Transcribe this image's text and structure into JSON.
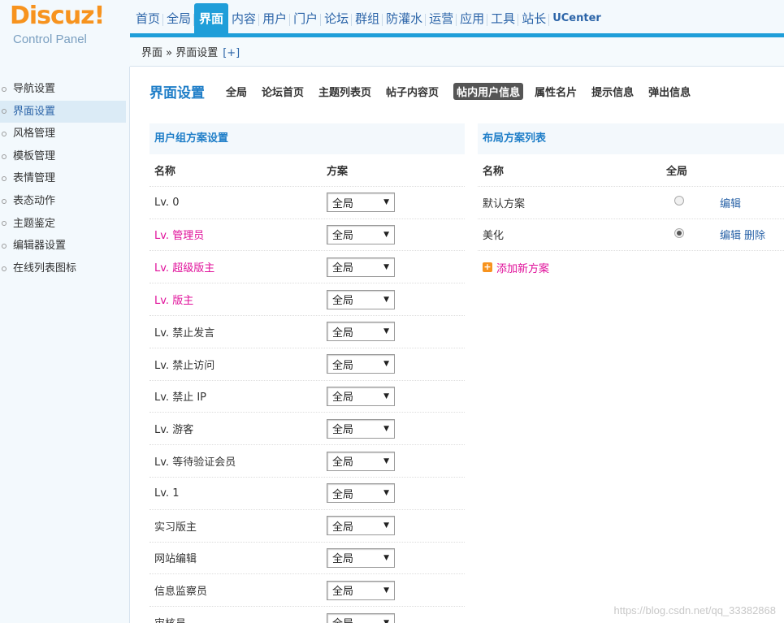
{
  "brand": {
    "logo": "Discuz!",
    "subtitle": "Control Panel"
  },
  "topnav": [
    {
      "label": "首页"
    },
    {
      "label": "全局"
    },
    {
      "label": "界面",
      "active": true
    },
    {
      "label": "内容"
    },
    {
      "label": "用户"
    },
    {
      "label": "门户"
    },
    {
      "label": "论坛"
    },
    {
      "label": "群组"
    },
    {
      "label": "防灌水"
    },
    {
      "label": "运营"
    },
    {
      "label": "应用"
    },
    {
      "label": "工具"
    },
    {
      "label": "站长"
    },
    {
      "label": "UCenter"
    }
  ],
  "breadcrumb": {
    "text": "界面 » 界面设置",
    "plus": "[+]"
  },
  "sidebar": [
    {
      "label": "导航设置"
    },
    {
      "label": "界面设置",
      "active": true
    },
    {
      "label": "风格管理"
    },
    {
      "label": "模板管理"
    },
    {
      "label": "表情管理"
    },
    {
      "label": "表态动作"
    },
    {
      "label": "主题鉴定"
    },
    {
      "label": "编辑器设置"
    },
    {
      "label": "在线列表图标"
    }
  ],
  "page": {
    "title": "界面设置",
    "tabs": [
      {
        "label": "全局"
      },
      {
        "label": "论坛首页"
      },
      {
        "label": "主题列表页"
      },
      {
        "label": "帖子内容页"
      },
      {
        "label": "帖内用户信息",
        "active": true
      },
      {
        "label": "属性名片"
      },
      {
        "label": "提示信息"
      },
      {
        "label": "弹出信息"
      }
    ]
  },
  "usergroups": {
    "heading": "用户组方案设置",
    "col_name": "名称",
    "col_scheme": "方案",
    "rows": [
      {
        "name": "Lv. 0",
        "scheme": "全局",
        "pink": false
      },
      {
        "name": "Lv. 管理员",
        "scheme": "全局",
        "pink": true
      },
      {
        "name": "Lv. 超级版主",
        "scheme": "全局",
        "pink": true
      },
      {
        "name": "Lv. 版主",
        "scheme": "全局",
        "pink": true
      },
      {
        "name": "Lv. 禁止发言",
        "scheme": "全局",
        "pink": false
      },
      {
        "name": "Lv. 禁止访问",
        "scheme": "全局",
        "pink": false
      },
      {
        "name": "Lv. 禁止 IP",
        "scheme": "全局",
        "pink": false
      },
      {
        "name": "Lv. 游客",
        "scheme": "全局",
        "pink": false
      },
      {
        "name": "Lv. 等待验证会员",
        "scheme": "全局",
        "pink": false
      },
      {
        "name": "Lv. 1",
        "scheme": "全局",
        "pink": false
      },
      {
        "name": "实习版主",
        "scheme": "全局",
        "pink": false
      },
      {
        "name": "网站编辑",
        "scheme": "全局",
        "pink": false
      },
      {
        "name": "信息监察员",
        "scheme": "全局",
        "pink": false
      },
      {
        "name": "审核员",
        "scheme": "全局",
        "pink": false
      }
    ]
  },
  "layouts": {
    "heading": "布局方案列表",
    "col_name": "名称",
    "col_global": "全局",
    "rows": [
      {
        "name": "默认方案",
        "selected": false,
        "actions": [
          "编辑"
        ]
      },
      {
        "name": "美化",
        "selected": true,
        "actions": [
          "编辑",
          "删除"
        ]
      }
    ],
    "add_label": "添加新方案"
  },
  "watermark": "https://blog.csdn.net/qq_33382868"
}
